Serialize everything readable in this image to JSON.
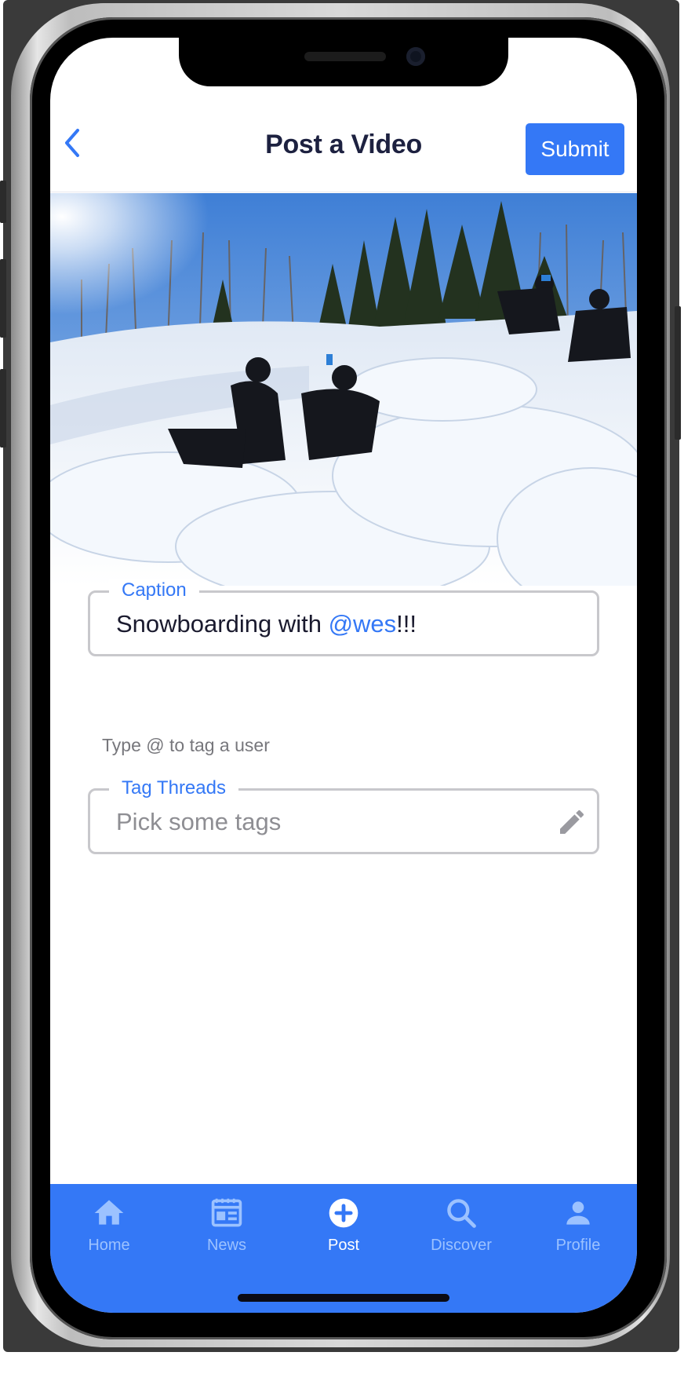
{
  "header": {
    "title": "Post a Video",
    "submit_label": "Submit"
  },
  "form": {
    "caption": {
      "label": "Caption",
      "value_prefix": "Snowboarding with ",
      "value_mention": "@wes",
      "value_suffix": "!!!",
      "helper": "Type @ to tag a user"
    },
    "tags": {
      "label": "Tag Threads",
      "placeholder": "Pick some tags"
    }
  },
  "tabbar": {
    "items": [
      {
        "label": "Home",
        "icon": "home-icon",
        "active": false
      },
      {
        "label": "News",
        "icon": "newspaper-icon",
        "active": false
      },
      {
        "label": "Post",
        "icon": "plus-circle-icon",
        "active": true
      },
      {
        "label": "Discover",
        "icon": "search-icon",
        "active": false
      },
      {
        "label": "Profile",
        "icon": "person-icon",
        "active": false
      }
    ]
  },
  "colors": {
    "accent": "#3478f6",
    "title": "#1d2140",
    "tab_inactive": "#9cc2ff",
    "field_border": "#c8c8cc"
  }
}
